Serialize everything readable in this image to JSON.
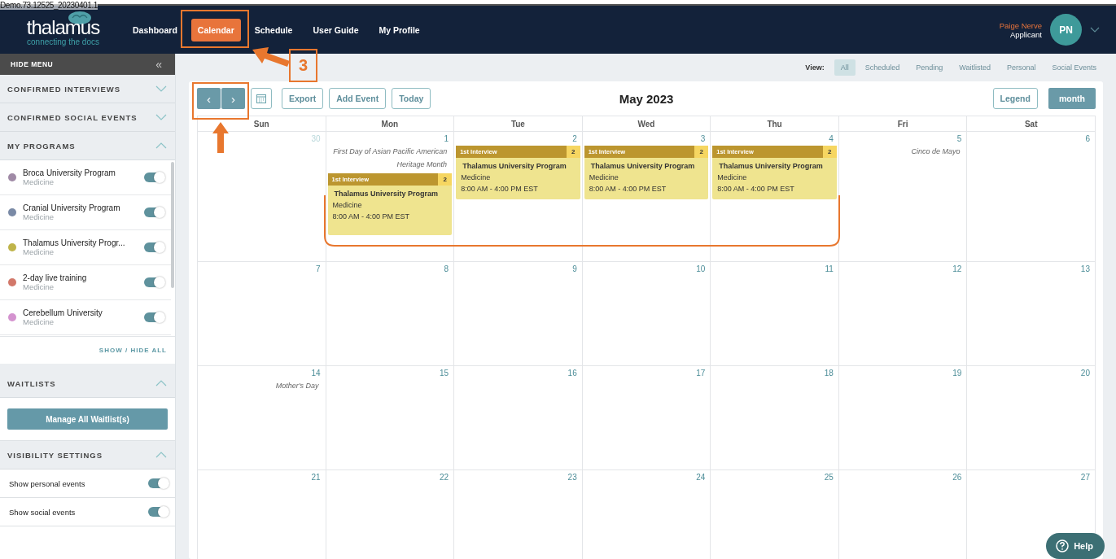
{
  "build_label": "Demo.73.12525_20230401.1",
  "header": {
    "logo": "thalamus",
    "tagline": "connecting the docs",
    "nav": [
      {
        "label": "Dashboard",
        "selected": false
      },
      {
        "label": "Calendar",
        "selected": true
      },
      {
        "label": "Schedule",
        "selected": false
      },
      {
        "label": "User Guide",
        "selected": false
      },
      {
        "label": "My Profile",
        "selected": false
      }
    ],
    "user": {
      "name": "Paige Nerve",
      "role": "Applicant",
      "initials": "PN"
    }
  },
  "sidebar": {
    "hide_menu": "HIDE MENU",
    "collapse_icon": "«",
    "sections": [
      {
        "kind": "plain",
        "title": "CONFIRMED INTERVIEWS",
        "expanded": false
      },
      {
        "kind": "plain",
        "title": "CONFIRMED SOCIAL EVENTS",
        "expanded": false
      },
      {
        "kind": "programs",
        "title": "MY PROGRAMS",
        "expanded": true,
        "footer_link": "SHOW / HIDE ALL",
        "items": [
          {
            "name": "Broca University Program",
            "specialty": "Medicine",
            "color": "#a08aa6",
            "on": true
          },
          {
            "name": "Cranial University Program",
            "specialty": "Medicine",
            "color": "#7a8aa6",
            "on": true
          },
          {
            "name": "Thalamus University Progr...",
            "specialty": "Medicine",
            "color": "#bfb44a",
            "on": true
          },
          {
            "name": "2-day live training",
            "specialty": "Medicine",
            "color": "#d2786a",
            "on": true
          },
          {
            "name": "Cerebellum University",
            "specialty": "Medicine",
            "color": "#d493cf",
            "on": true
          }
        ]
      },
      {
        "kind": "button",
        "title": "WAITLISTS",
        "expanded": true,
        "button": "Manage All Waitlist(s)"
      },
      {
        "kind": "toggles",
        "title": "VISIBILITY SETTINGS",
        "expanded": true,
        "items": [
          {
            "label": "Show personal events",
            "on": true
          },
          {
            "label": "Show social events",
            "on": true
          }
        ]
      }
    ]
  },
  "view": {
    "label": "View:",
    "filters": [
      {
        "label": "All",
        "selected": true
      },
      {
        "label": "Scheduled",
        "selected": false
      },
      {
        "label": "Pending",
        "selected": false
      },
      {
        "label": "Waitlisted",
        "selected": false
      },
      {
        "label": "Personal",
        "selected": false
      },
      {
        "label": "Social Events",
        "selected": false
      }
    ]
  },
  "calendar": {
    "prev": "‹",
    "next": "›",
    "buttons": [
      "Export",
      "Add Event",
      "Today"
    ],
    "title": "May 2023",
    "legend": "Legend",
    "view_button": "month",
    "weekdays": [
      "Sun",
      "Mon",
      "Tue",
      "Wed",
      "Thu",
      "Fri",
      "Sat"
    ],
    "weeks": [
      [
        {
          "day": "30",
          "other_month": true
        },
        {
          "day": "1",
          "other_month": false,
          "holiday": "First Day of Asian Pacific American Heritage Month",
          "events": [
            {
              "type": "1st Interview",
              "count": "2",
              "program": "Thalamus University Program",
              "specialty": "Medicine",
              "time": "8:00 AM - 4:00 PM EST"
            }
          ]
        },
        {
          "day": "2",
          "other_month": false,
          "events": [
            {
              "type": "1st Interview",
              "count": "2",
              "program": "Thalamus University Program",
              "specialty": "Medicine",
              "time": "8:00 AM - 4:00 PM EST"
            }
          ]
        },
        {
          "day": "3",
          "other_month": false,
          "events": [
            {
              "type": "1st Interview",
              "count": "2",
              "program": "Thalamus University Program",
              "specialty": "Medicine",
              "time": "8:00 AM - 4:00 PM EST"
            }
          ]
        },
        {
          "day": "4",
          "other_month": false,
          "events": [
            {
              "type": "1st Interview",
              "count": "2",
              "program": "Thalamus University Program",
              "specialty": "Medicine",
              "time": "8:00 AM - 4:00 PM EST"
            }
          ]
        },
        {
          "day": "5",
          "other_month": false,
          "holiday": "Cinco de Mayo"
        },
        {
          "day": "6",
          "other_month": false
        }
      ],
      [
        {
          "day": "7",
          "other_month": false
        },
        {
          "day": "8",
          "other_month": false
        },
        {
          "day": "9",
          "other_month": false
        },
        {
          "day": "10",
          "other_month": false
        },
        {
          "day": "11",
          "other_month": false
        },
        {
          "day": "12",
          "other_month": false
        },
        {
          "day": "13",
          "other_month": false
        }
      ],
      [
        {
          "day": "14",
          "other_month": false,
          "holiday": "Mother's Day"
        },
        {
          "day": "15",
          "other_month": false
        },
        {
          "day": "16",
          "other_month": false
        },
        {
          "day": "17",
          "other_month": false
        },
        {
          "day": "18",
          "other_month": false
        },
        {
          "day": "19",
          "other_month": false
        },
        {
          "day": "20",
          "other_month": false
        }
      ],
      [
        {
          "day": "21",
          "other_month": false
        },
        {
          "day": "22",
          "other_month": false
        },
        {
          "day": "23",
          "other_month": false
        },
        {
          "day": "24",
          "other_month": false
        },
        {
          "day": "25",
          "other_month": false
        },
        {
          "day": "26",
          "other_month": false
        },
        {
          "day": "27",
          "other_month": false
        }
      ]
    ]
  },
  "help": {
    "label": "Help"
  },
  "annotation": {
    "step_number": "3"
  }
}
